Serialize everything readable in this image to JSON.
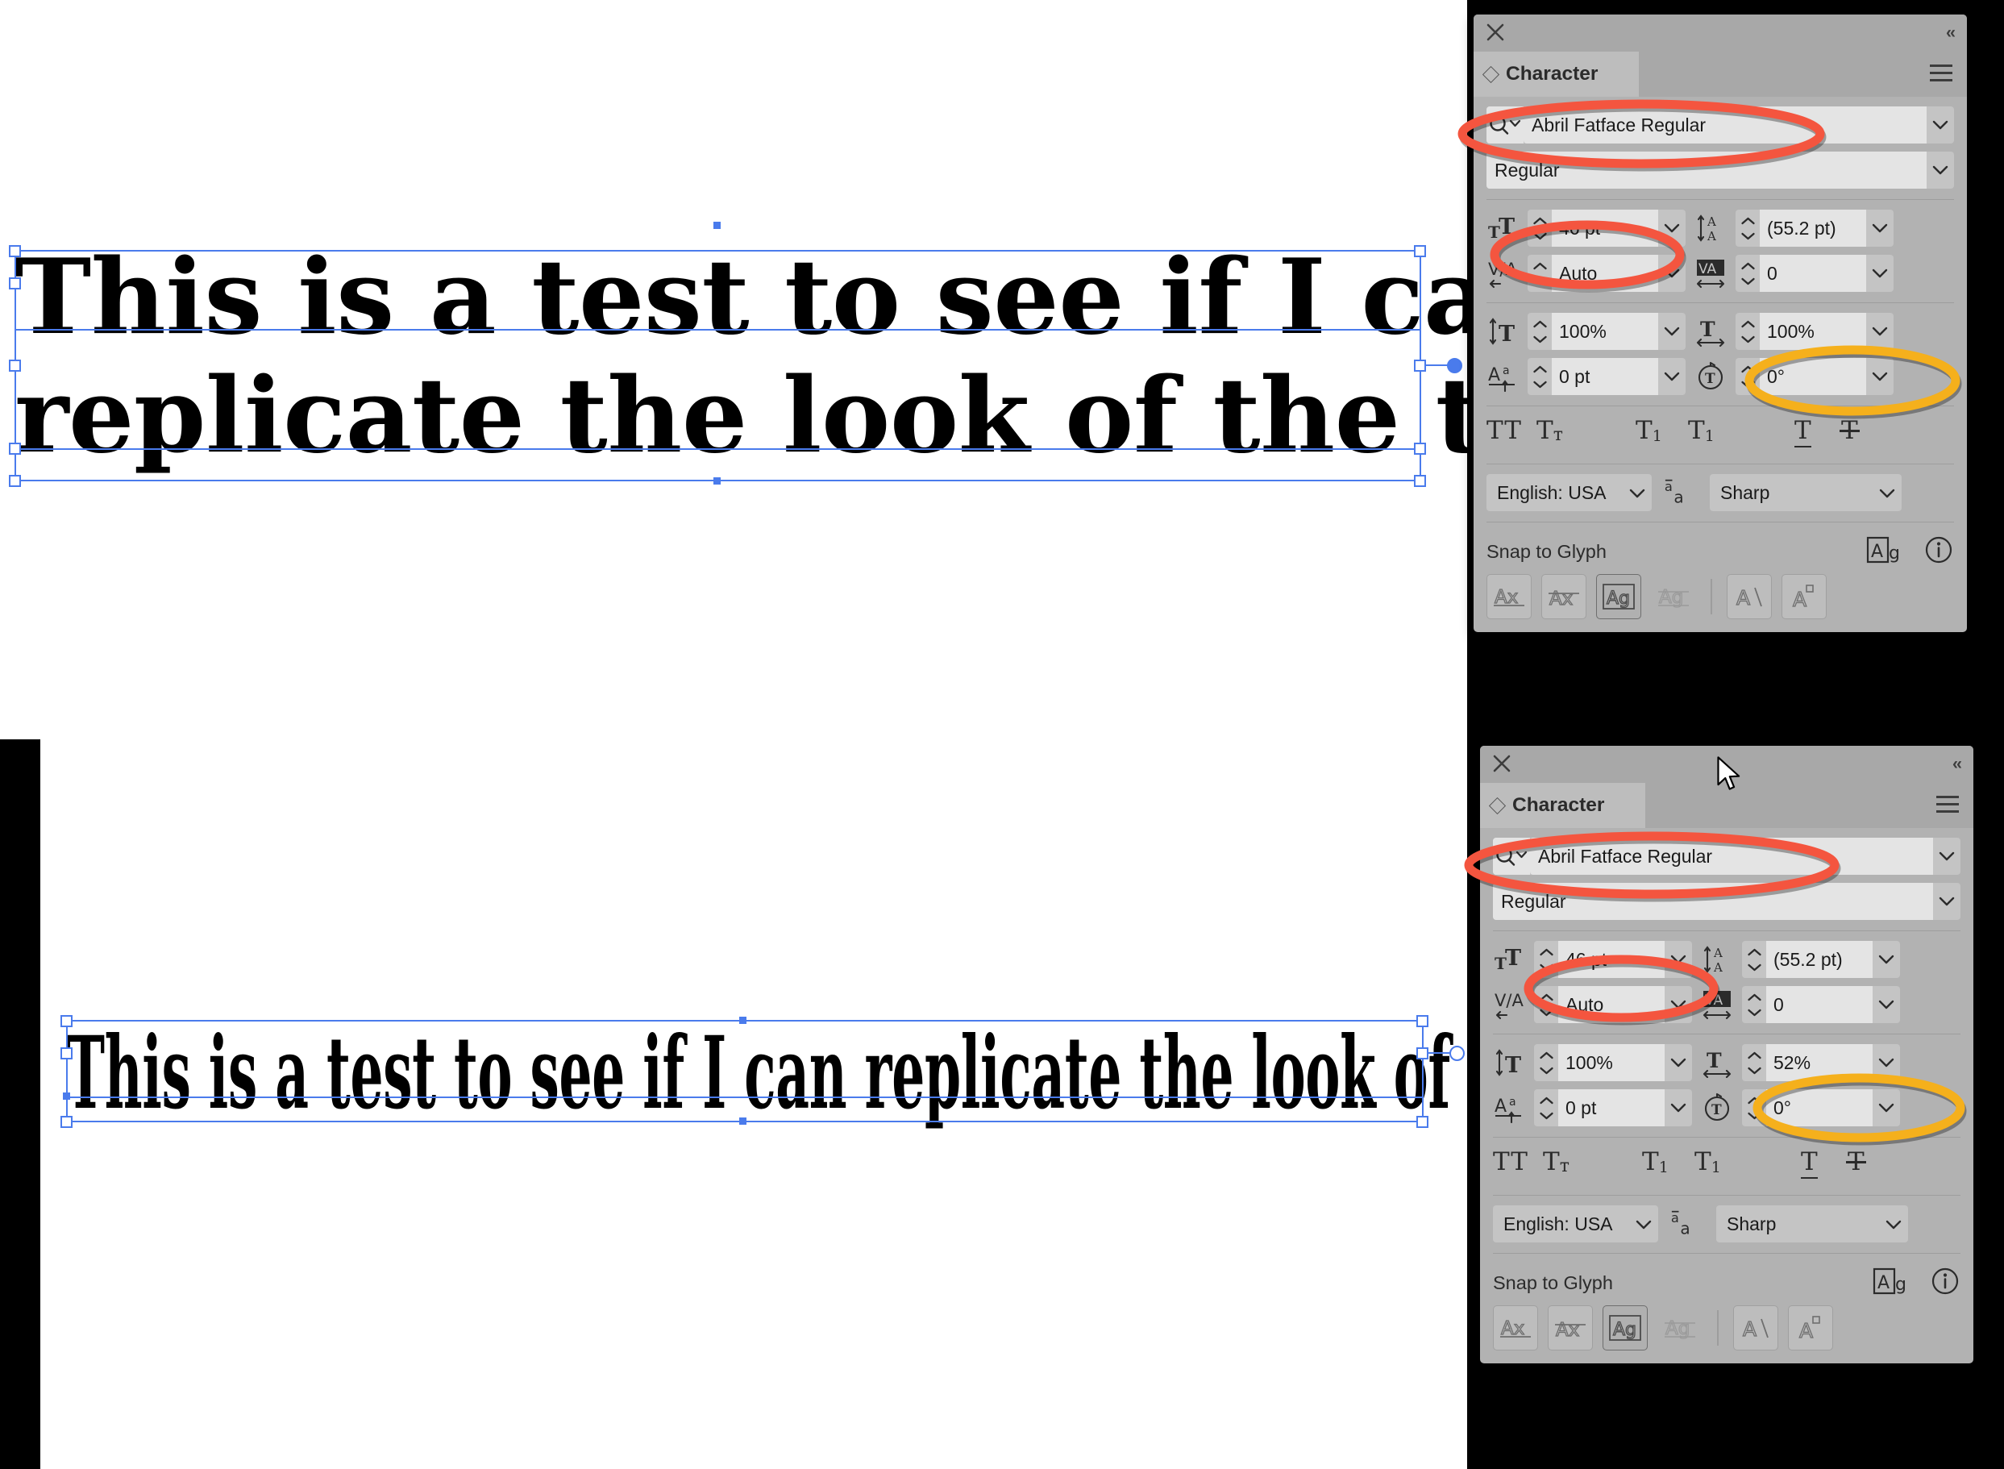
{
  "app": {
    "panel_title": "Character",
    "close_icon": "close-icon",
    "collapse_icon": "collapse-panel-icon",
    "menu_icon": "panel-menu-icon"
  },
  "colors": {
    "panel_bg": "#b2b2b2",
    "panel_titlebar": "#a8a8a8",
    "input_bg": "#e4e4e4",
    "combo_bg": "#c4c4c4",
    "selection_blue": "#4a7bec",
    "annotation_red": "#f4553f",
    "annotation_yellow": "#f5b01c",
    "text": "#1a1a1a"
  },
  "artwork": {
    "text_block_1": {
      "line_1": "This is a test to see if I can",
      "line_2": "replicate the look of the type.",
      "horizontal_scale": "100%"
    },
    "text_block_2": {
      "line_1": "This is a test to see if I can replicate the look of the type.",
      "horizontal_scale": "52%"
    }
  },
  "panels": [
    {
      "id": "character-panel-top",
      "title": "Character",
      "font_family": {
        "value": "Abril Fatface Regular",
        "search_icon": "search-icon",
        "highlighted": true,
        "highlight_color": "red"
      },
      "font_style": {
        "value": "Regular"
      },
      "font_size": {
        "icon": "font-size-icon",
        "value": "46 pt",
        "highlighted": true,
        "highlight_color": "red"
      },
      "leading": {
        "icon": "leading-icon",
        "value": "(55.2 pt)"
      },
      "kerning": {
        "icon": "kerning-icon",
        "value": "Auto"
      },
      "tracking": {
        "icon": "tracking-icon",
        "value": "0"
      },
      "vertical_scale": {
        "icon": "vertical-scale-icon",
        "value": "100%"
      },
      "horizontal_scale": {
        "icon": "horizontal-scale-icon",
        "value": "100%",
        "highlighted": true,
        "highlight_color": "yellow"
      },
      "baseline_shift": {
        "icon": "baseline-shift-icon",
        "value": "0 pt"
      },
      "rotation": {
        "icon": "character-rotation-icon",
        "value": "0°"
      },
      "style_buttons": [
        {
          "name": "all-caps-button",
          "label": "TT"
        },
        {
          "name": "small-caps-button",
          "label": "Tᴛ"
        },
        {
          "name": "superscript-button",
          "label": "T¹"
        },
        {
          "name": "subscript-button",
          "label": "T₁"
        },
        {
          "name": "underline-button",
          "label": "T"
        },
        {
          "name": "strikethrough-button",
          "label": "T"
        }
      ],
      "language": {
        "value": "English: USA"
      },
      "anti_aliasing": {
        "icon": "anti-aliasing-icon",
        "value": "Sharp"
      },
      "snap_to_glyph": {
        "label": "Snap to Glyph",
        "preview_icon": "ag-preview-icon",
        "info_icon": "info-icon",
        "buttons": [
          {
            "name": "snap-baseline-button",
            "label": "Ax",
            "state": "normal"
          },
          {
            "name": "snap-xheight-button",
            "label": "Āx",
            "state": "normal"
          },
          {
            "name": "snap-embox-button",
            "label": "Ag",
            "state": "active"
          },
          {
            "name": "snap-capheight-button",
            "label": "Āg",
            "state": "disabled"
          },
          {
            "name": "snap-angle-button",
            "label": "A\\",
            "state": "normal"
          },
          {
            "name": "snap-point-button",
            "label": "A▫",
            "state": "normal"
          }
        ]
      }
    },
    {
      "id": "character-panel-bottom",
      "title": "Character",
      "font_family": {
        "value": "Abril Fatface Regular",
        "search_icon": "search-icon",
        "highlighted": true,
        "highlight_color": "red"
      },
      "font_style": {
        "value": "Regular"
      },
      "font_size": {
        "icon": "font-size-icon",
        "value": "46 pt",
        "highlighted": true,
        "highlight_color": "red"
      },
      "leading": {
        "icon": "leading-icon",
        "value": "(55.2 pt)"
      },
      "kerning": {
        "icon": "kerning-icon",
        "value": "Auto"
      },
      "tracking": {
        "icon": "tracking-icon",
        "value": "0"
      },
      "vertical_scale": {
        "icon": "vertical-scale-icon",
        "value": "100%"
      },
      "horizontal_scale": {
        "icon": "horizontal-scale-icon",
        "value": "52%",
        "highlighted": true,
        "highlight_color": "yellow"
      },
      "baseline_shift": {
        "icon": "baseline-shift-icon",
        "value": "0 pt"
      },
      "rotation": {
        "icon": "character-rotation-icon",
        "value": "0°"
      },
      "style_buttons": [
        {
          "name": "all-caps-button",
          "label": "TT"
        },
        {
          "name": "small-caps-button",
          "label": "Tᴛ"
        },
        {
          "name": "superscript-button",
          "label": "T¹"
        },
        {
          "name": "subscript-button",
          "label": "T₁"
        },
        {
          "name": "underline-button",
          "label": "T"
        },
        {
          "name": "strikethrough-button",
          "label": "T"
        }
      ],
      "language": {
        "value": "English: USA"
      },
      "anti_aliasing": {
        "icon": "anti-aliasing-icon",
        "value": "Sharp"
      },
      "snap_to_glyph": {
        "label": "Snap to Glyph",
        "preview_icon": "ag-preview-icon",
        "info_icon": "info-icon",
        "buttons": [
          {
            "name": "snap-baseline-button",
            "label": "Ax",
            "state": "normal"
          },
          {
            "name": "snap-xheight-button",
            "label": "Āx",
            "state": "normal"
          },
          {
            "name": "snap-embox-button",
            "label": "Ag",
            "state": "active"
          },
          {
            "name": "snap-capheight-button",
            "label": "Āg",
            "state": "disabled"
          },
          {
            "name": "snap-angle-button",
            "label": "A\\",
            "state": "normal"
          },
          {
            "name": "snap-point-button",
            "label": "A▫",
            "state": "normal"
          }
        ]
      }
    }
  ]
}
